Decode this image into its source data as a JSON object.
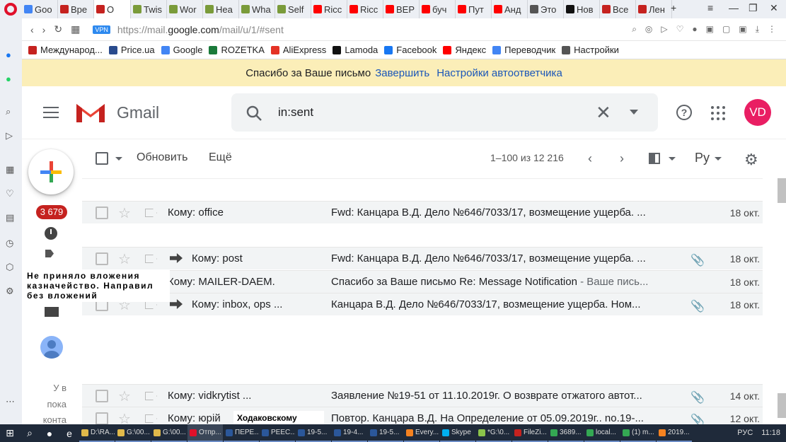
{
  "tabs": [
    {
      "label": "Goo",
      "color": "#4285f4"
    },
    {
      "label": "Вре",
      "color": "#c5221f"
    },
    {
      "label": "O",
      "color": "#c5221f",
      "active": true
    },
    {
      "label": "Twis",
      "color": "#7a9b3a"
    },
    {
      "label": "Wor",
      "color": "#7a9b3a"
    },
    {
      "label": "Hea",
      "color": "#7a9b3a"
    },
    {
      "label": "Wha",
      "color": "#7a9b3a"
    },
    {
      "label": "Self",
      "color": "#7a9b3a"
    },
    {
      "label": "Ricc",
      "color": "#ff0000"
    },
    {
      "label": "Ricc",
      "color": "#ff0000"
    },
    {
      "label": "ВЕР",
      "color": "#ff0000"
    },
    {
      "label": "буч",
      "color": "#ff0000"
    },
    {
      "label": "Пут",
      "color": "#ff0000"
    },
    {
      "label": "Анд",
      "color": "#ff0000"
    },
    {
      "label": "Это",
      "color": "#555555"
    },
    {
      "label": "Нов",
      "color": "#111111"
    },
    {
      "label": "Все",
      "color": "#c5221f"
    },
    {
      "label": "Лен",
      "color": "#c5221f"
    }
  ],
  "browser": {
    "vpn": "VPN",
    "url_prefix": "https://mail.",
    "url_domain": "google.com",
    "url_path": "/mail/u/1/#sent"
  },
  "bookmarks": [
    {
      "label": "Международ...",
      "color": "#c5221f"
    },
    {
      "label": "Price.ua",
      "color": "#2a4b8d"
    },
    {
      "label": "Google",
      "color": "#4285f4"
    },
    {
      "label": "ROZETKA",
      "color": "#1a7a3a"
    },
    {
      "label": "AliExpress",
      "color": "#e43225"
    },
    {
      "label": "Lamoda",
      "color": "#111111"
    },
    {
      "label": "Facebook",
      "color": "#1877f2"
    },
    {
      "label": "Яндекс",
      "color": "#ff0000"
    },
    {
      "label": "Переводчик",
      "color": "#4285f4"
    },
    {
      "label": "Настройки",
      "color": "#555555"
    }
  ],
  "banner": {
    "text": "Спасибо за Ваше письмо",
    "finish": "Завершить",
    "settings": "Настройки автоответчика"
  },
  "gmail": {
    "brand": "Gmail",
    "search_value": "in:sent",
    "avatar_initials": "VD",
    "avatar_color": "#e91e63",
    "unread_count": "3 679"
  },
  "toolbar": {
    "refresh": "Обновить",
    "more": "Ещё",
    "page_info": "1–100 из 12 216",
    "lang": "Ру"
  },
  "sidebar_hint": [
    "У в",
    "пока",
    "конта"
  ],
  "tooltip": "Не приняло вложения казначейство. Направил без вложений",
  "note": "Ходаковскому",
  "rows": [
    {
      "sender": "Кому: office",
      "subject": "Fwd: Канцара В.Д. Дело №646/7033/17, возмещение ущерба. ...",
      "snippet": "",
      "date": "18 окт.",
      "attach": false,
      "forwarded": false
    },
    {
      "sender": "Кому: post",
      "subject": "Fwd: Канцара В.Д. Дело №646/7033/17, возмещение ущерба. ...",
      "snippet": "",
      "date": "18 окт.",
      "attach": true,
      "forwarded": true
    },
    {
      "sender": "Кому: MAILER-DAEM.",
      "subject": "Спасибо за Ваше письмо Re: Message Notification",
      "snippet": " - Ваше пись...",
      "date": "18 окт.",
      "attach": false,
      "forwarded": false
    },
    {
      "sender": "Кому: inbox, ops ...",
      "subject": "Канцара В.Д. Дело №646/7033/17, возмещение ущерба. Ном...",
      "snippet": "",
      "date": "18 окт.",
      "attach": true,
      "forwarded": true
    },
    {
      "sender": "Кому: vidkrytist ...",
      "subject": "Заявление №19-51 от 11.10.2019г. О возврате отжатого автот...",
      "snippet": "",
      "date": "14 окт.",
      "attach": true,
      "forwarded": false
    },
    {
      "sender": "Кому: юрій",
      "subject": "Повтор. Канцара В.Д. На Определение от 05.09.2019г.. no.19-...",
      "snippet": "",
      "date": "12 окт.",
      "attach": true,
      "forwarded": false
    }
  ],
  "taskbar": [
    {
      "label": "D:\\RA...",
      "color": "#e0b94a"
    },
    {
      "label": "G:\\00...",
      "color": "#e0b94a"
    },
    {
      "label": "G:\\00...",
      "color": "#e0b94a"
    },
    {
      "label": "Отпр...",
      "color": "#e0102a",
      "active": true
    },
    {
      "label": "ПЕРЕ...",
      "color": "#2b579a"
    },
    {
      "label": "РЕЕС...",
      "color": "#2b579a"
    },
    {
      "label": "19-5...",
      "color": "#2b579a"
    },
    {
      "label": "19-4...",
      "color": "#2b579a"
    },
    {
      "label": "19-5...",
      "color": "#2b579a"
    },
    {
      "label": "Every...",
      "color": "#f58220"
    },
    {
      "label": "Skype",
      "color": "#00aff0"
    },
    {
      "label": "*G:\\0...",
      "color": "#8bc34a"
    },
    {
      "label": "FileZi...",
      "color": "#c5221f"
    },
    {
      "label": "3689...",
      "color": "#34a853"
    },
    {
      "label": "local...",
      "color": "#34a853"
    },
    {
      "label": "(1) m...",
      "color": "#34a853"
    },
    {
      "label": "2019...",
      "color": "#f58220"
    }
  ],
  "tray": {
    "lang": "РУС",
    "time": "11:18"
  }
}
